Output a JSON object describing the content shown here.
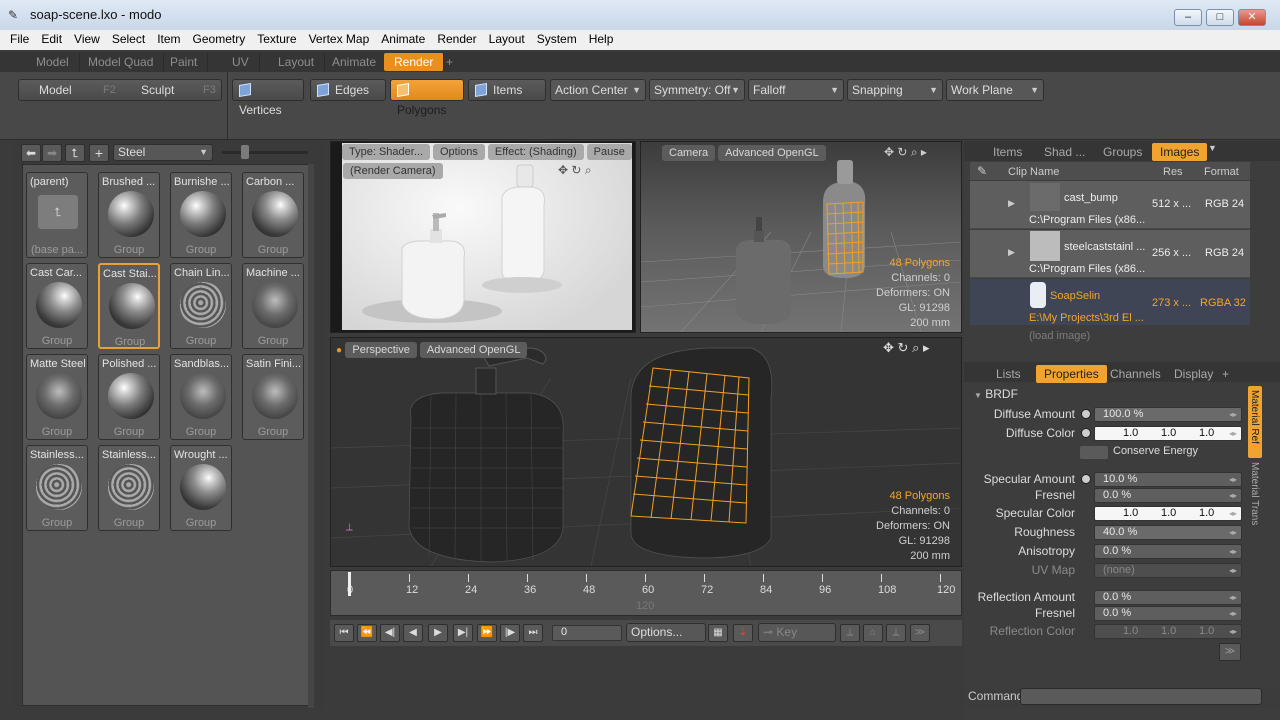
{
  "window": {
    "title": "soap-scene.lxo - modo",
    "min": "–",
    "max": "□",
    "close": "✕"
  },
  "menu": [
    "File",
    "Edit",
    "View",
    "Select",
    "Item",
    "Geometry",
    "Texture",
    "Vertex Map",
    "Animate",
    "Render",
    "Layout",
    "System",
    "Help"
  ],
  "layout_tabs": [
    "Model",
    "Model Quad",
    "Paint",
    "UV",
    "Layout",
    "Animate",
    "Render",
    "+"
  ],
  "toolbar": {
    "model": "Model",
    "model_key": "F2",
    "sculpt": "Sculpt",
    "sculpt_key": "F3",
    "vertices": "Vertices",
    "edges": "Edges",
    "polygons": "Polygons",
    "items": "Items",
    "action_center": "Action Center",
    "symmetry": "Symmetry: Off",
    "falloff": "Falloff",
    "snapping": "Snapping",
    "work_plane": "Work Plane"
  },
  "preset_browser": {
    "filter": "Steel",
    "tiles": [
      {
        "name": "(parent)",
        "sub": "(base pa..."
      },
      {
        "name": "Brushed ...",
        "sub": "Group"
      },
      {
        "name": "Burnishe ...",
        "sub": "Group"
      },
      {
        "name": "Carbon ...",
        "sub": "Group"
      },
      {
        "name": "Cast Car...",
        "sub": "Group"
      },
      {
        "name": "Cast Stai...",
        "sub": "Group"
      },
      {
        "name": "Chain Lin...",
        "sub": "Group"
      },
      {
        "name": "Machine ...",
        "sub": "Group"
      },
      {
        "name": "Matte Steel",
        "sub": "Group"
      },
      {
        "name": "Polished ...",
        "sub": "Group"
      },
      {
        "name": "Sandblas...",
        "sub": "Group"
      },
      {
        "name": "Satin Fini...",
        "sub": "Group"
      },
      {
        "name": "Stainless...",
        "sub": "Group"
      },
      {
        "name": "Stainless...",
        "sub": "Group"
      },
      {
        "name": "Wrought ...",
        "sub": "Group"
      }
    ]
  },
  "render_view": {
    "type": "Type: Shader...",
    "options": "Options",
    "effect": "Effect: (Shading)",
    "pause": "Pause",
    "camera": "(Render Camera)"
  },
  "camera_view": {
    "camera": "Camera",
    "mode": "Advanced OpenGL",
    "polygons": "48 Polygons",
    "channels": "Channels: 0",
    "deformers": "Deformers: ON",
    "gl": "GL: 91298",
    "size": "200 mm"
  },
  "perspective_view": {
    "view": "Perspective",
    "mode": "Advanced OpenGL",
    "polygons": "48 Polygons",
    "channels": "Channels: 0",
    "deformers": "Deformers: ON",
    "gl": "GL: 91298",
    "size": "200 mm"
  },
  "timeline": {
    "ticks": [
      "0",
      "12",
      "24",
      "36",
      "48",
      "60",
      "72",
      "84",
      "96",
      "108",
      "120"
    ],
    "end": "120",
    "frame": "0",
    "options": "Options...",
    "key": "Key"
  },
  "right_tabs": [
    "Items",
    "Shad ...",
    "Groups",
    "Images"
  ],
  "clips": {
    "headers": [
      "Clip Name",
      "Res",
      "Format"
    ],
    "rows": [
      {
        "name": "cast_bump",
        "path": "C:\\Program Files (x86...",
        "res": "512 x ...",
        "format": "RGB 24"
      },
      {
        "name": "steelcaststainl ...",
        "path": "C:\\Program Files (x86...",
        "res": "256 x ...",
        "format": "RGB 24"
      },
      {
        "name": "SoapSelin",
        "path": "E:\\My Projects\\3rd El ...",
        "res": "273 x ...",
        "format": "RGBA 32"
      }
    ],
    "load": "(load image)"
  },
  "prop_tabs": [
    "Lists",
    "Properties",
    "Channels",
    "Display",
    "+"
  ],
  "side_tabs": [
    "Material Ref",
    "Material Trans"
  ],
  "properties": {
    "section": "BRDF",
    "diffuse_amount_label": "Diffuse Amount",
    "diffuse_amount": "100.0 %",
    "diffuse_color_label": "Diffuse Color",
    "diffuse_color": [
      "1.0",
      "1.0",
      "1.0"
    ],
    "conserve_energy": "Conserve Energy",
    "specular_amount_label": "Specular Amount",
    "specular_amount": "10.0 %",
    "fresnel_label": "Fresnel",
    "fresnel": "0.0 %",
    "specular_color_label": "Specular Color",
    "specular_color": [
      "1.0",
      "1.0",
      "1.0"
    ],
    "roughness_label": "Roughness",
    "roughness": "40.0 %",
    "anisotropy_label": "Anisotropy",
    "anisotropy": "0.0 %",
    "uvmap_label": "UV Map",
    "uvmap": "(none)",
    "reflection_amount_label": "Reflection Amount",
    "reflection_amount": "0.0 %",
    "refl_fresnel_label": "Fresnel",
    "refl_fresnel": "0.0 %",
    "reflection_color_label": "Reflection Color",
    "reflection_color": [
      "1.0",
      "1.0",
      "1.0"
    ]
  },
  "command": {
    "label": "Command"
  }
}
